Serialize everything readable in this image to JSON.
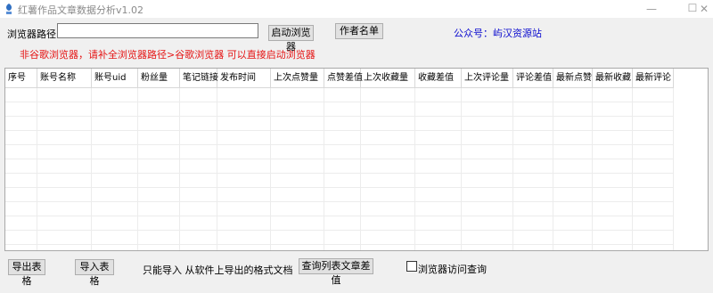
{
  "window": {
    "title": "红薯作品文章数据分析v1.02",
    "minimize": "—",
    "maximize": "☐",
    "close": "✕"
  },
  "toolbar": {
    "path_label": "浏览器路径：",
    "path_value": "",
    "launch_browser": "启动浏览器",
    "author_list": "作者名单",
    "wechat_account": "公众号：屿汉资源站"
  },
  "warning_text": "非谷歌浏览器，请补全浏览器路径>谷歌浏览器 可以直接启动浏览器",
  "table": {
    "columns": [
      "序号",
      "账号名称",
      "账号uid",
      "粉丝量",
      "笔记链接",
      "发布时间",
      "上次点赞量",
      "点赞差值",
      "上次收藏量",
      "收藏差值",
      "上次评论量",
      "评论差值",
      "最新点赞",
      "最新收藏",
      "最新评论"
    ],
    "rows": []
  },
  "bottom": {
    "export_label": "导出表格",
    "import_label": "导入表格",
    "import_note": "只能导入 从软件上导出的格式文档",
    "query_label": "查询列表文章差值",
    "browser_access_label": "浏览器访问查询",
    "browser_access_checked": false
  }
}
